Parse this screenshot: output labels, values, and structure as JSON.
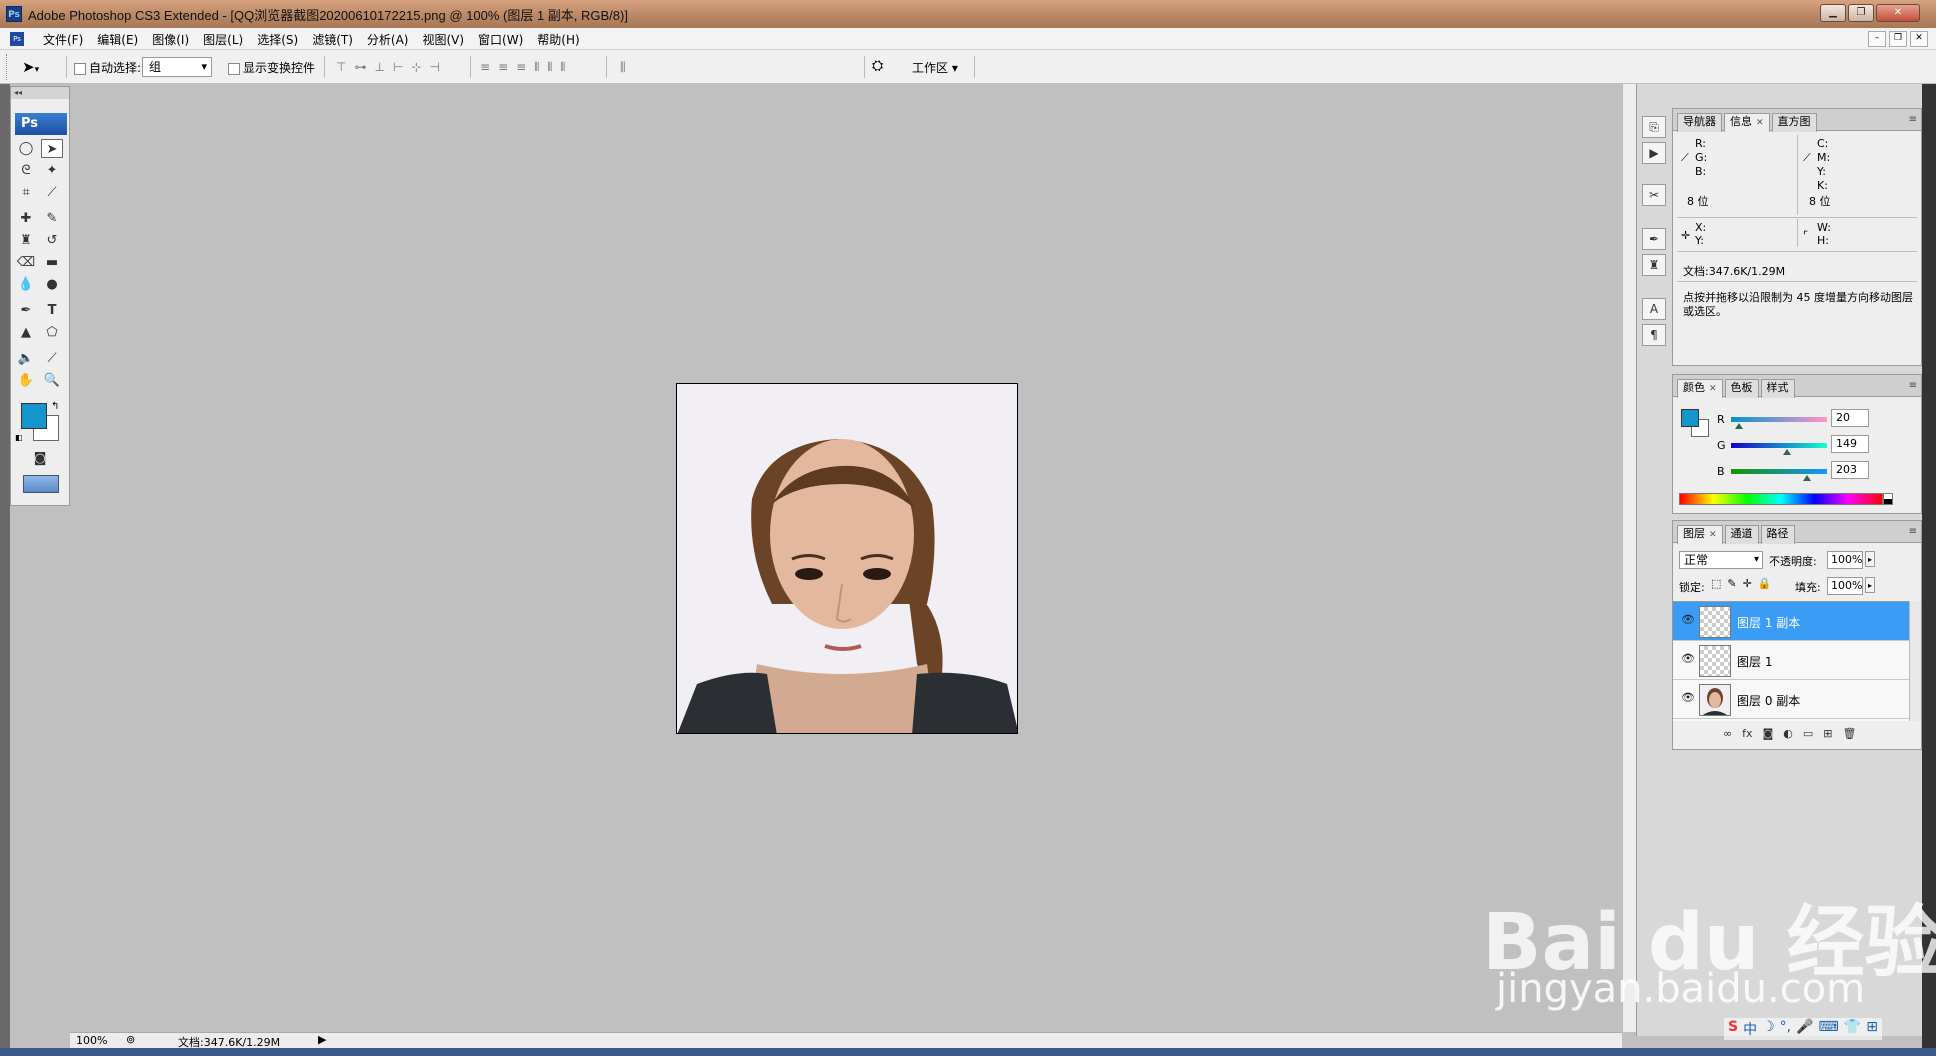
{
  "window": {
    "title": "Adobe Photoshop CS3 Extended - [QQ浏览器截图20200610172215.png @ 100% (图层 1 副本, RGB/8)]",
    "app_icon": "Ps"
  },
  "menu": {
    "items": [
      "文件(F)",
      "编辑(E)",
      "图像(I)",
      "图层(L)",
      "选择(S)",
      "滤镜(T)",
      "分析(A)",
      "视图(V)",
      "窗口(W)",
      "帮助(H)"
    ]
  },
  "options": {
    "auto_select_label": "自动选择:",
    "auto_select_value": "组",
    "show_transform_label": "显示变换控件",
    "workspace_label": "工作区 ▾"
  },
  "toolbox": {
    "logo": "Ps",
    "foreground_color": "#1495cb",
    "background_color": "#ffffff"
  },
  "info_panel": {
    "tabs": [
      "导航器",
      "信息",
      "直方图"
    ],
    "rgb_labels": [
      "R:",
      "G:",
      "B:"
    ],
    "cmyk_labels": [
      "C:",
      "M:",
      "Y:",
      "K:"
    ],
    "bit_left": "8 位",
    "bit_right": "8 位",
    "xy_labels": [
      "X:",
      "Y:"
    ],
    "wh_labels": [
      "W:",
      "H:"
    ],
    "doc_size": "文档:347.6K/1.29M",
    "hint": "点按并拖移以沿限制为 45 度增量方向移动图层或选区。"
  },
  "color_panel": {
    "tabs": [
      "颜色",
      "色板",
      "样式"
    ],
    "r_label": "R",
    "g_label": "G",
    "b_label": "B",
    "r_value": "20",
    "g_value": "149",
    "b_value": "203",
    "swatch": "#1495cb"
  },
  "layers_panel": {
    "tabs": [
      "图层",
      "通道",
      "路径"
    ],
    "blend_mode": "正常",
    "opacity_label": "不透明度:",
    "opacity_value": "100%",
    "lock_label": "锁定:",
    "fill_label": "填充:",
    "fill_value": "100%",
    "layers": [
      {
        "name": "图层 1 副本",
        "selected": true,
        "thumb": "transparent"
      },
      {
        "name": "图层 1",
        "selected": false,
        "thumb": "transparent"
      },
      {
        "name": "图层 0 副本",
        "selected": false,
        "thumb": "photo"
      }
    ]
  },
  "statusbar": {
    "zoom": "100%",
    "doc": "文档:347.6K/1.29M"
  },
  "watermark": {
    "main": "Bai du 经验",
    "sub": "jingyan.baidu.com"
  },
  "ime_text": "中"
}
